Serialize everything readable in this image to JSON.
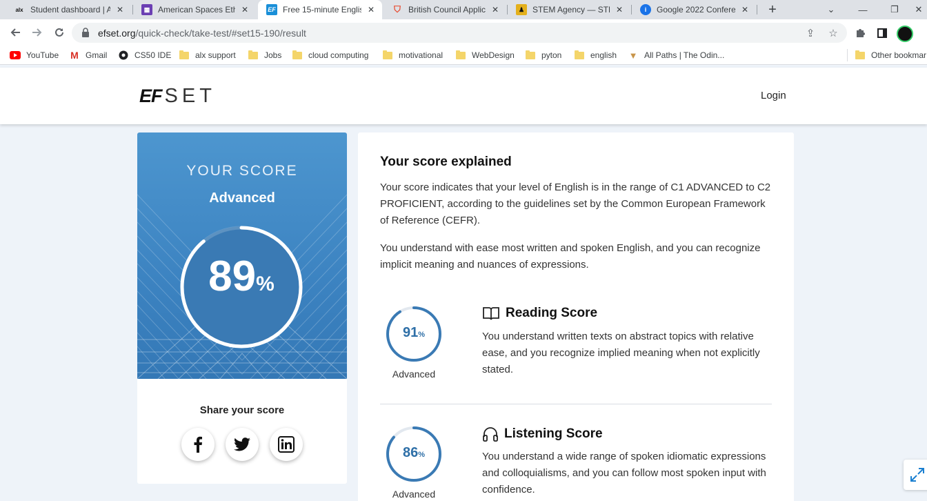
{
  "browser": {
    "tabs": [
      {
        "favicon": "alx",
        "title": "Student dashboard | A",
        "active": false
      },
      {
        "favicon": "purple-grid",
        "title": "American Spaces Ethic",
        "active": false
      },
      {
        "favicon": "EF",
        "title": "Free 15-minute Englis",
        "active": true
      },
      {
        "favicon": "b-shield",
        "title": "British Council Applica",
        "active": false
      },
      {
        "favicon": "stem-person",
        "title": "STEM Agency — STEM",
        "active": false
      },
      {
        "favicon": "info-blue",
        "title": "Google 2022 Confere",
        "active": false
      }
    ],
    "url_host": "efset.org",
    "url_path": "/quick-check/take-test/#set15-190/result",
    "bookmarks": [
      {
        "icon": "youtube-icon",
        "label": "YouTube"
      },
      {
        "icon": "gmail-icon",
        "label": "Gmail"
      },
      {
        "icon": "cs50-icon",
        "label": "CS50 IDE"
      },
      {
        "icon": "folder-icon",
        "label": "alx support"
      },
      {
        "icon": "folder-icon",
        "label": "Jobs"
      },
      {
        "icon": "folder-icon",
        "label": "cloud computing"
      },
      {
        "icon": "folder-icon",
        "label": "motivational"
      },
      {
        "icon": "folder-icon",
        "label": "WebDesign"
      },
      {
        "icon": "folder-icon",
        "label": "pyton"
      },
      {
        "icon": "folder-icon",
        "label": "english"
      },
      {
        "icon": "odin-icon",
        "label": "All Paths | The Odin..."
      }
    ],
    "other_bookmarks": "Other bookmar"
  },
  "header": {
    "logo_ef": "EF",
    "logo_set": "SET",
    "login": "Login"
  },
  "score": {
    "heading": "YOUR SCORE",
    "level": "Advanced",
    "value": "89",
    "percent_sign": "%",
    "fraction": 0.89
  },
  "share": {
    "title": "Share your score",
    "buttons": [
      "facebook-icon",
      "twitter-icon",
      "linkedin-icon"
    ]
  },
  "explain": {
    "title": "Your score explained",
    "paragraph1": "Your score indicates that your level of English is in the range of C1 ADVANCED to C2 PROFICIENT, according to the guidelines set by the Common European Framework of Reference (CEFR).",
    "paragraph2": "You understand with ease most written and spoken English, and you can recognize implicit meaning and nuances of expressions."
  },
  "subscores": [
    {
      "name": "Reading Score",
      "icon": "book-icon",
      "value": "91",
      "fraction": 0.91,
      "level": "Advanced",
      "description": "You understand written texts on abstract topics with relative ease, and you recognize implied meaning when not explicitly stated."
    },
    {
      "name": "Listening Score",
      "icon": "headphones-icon",
      "value": "86",
      "fraction": 0.86,
      "level": "Advanced",
      "description": "You understand a wide range of spoken idiomatic expressions and colloquialisms, and you can follow most spoken input with confidence."
    }
  ],
  "colors": {
    "accent": "#3c83c1",
    "ring": "#3a7ab4",
    "page_bg": "#eef3f9"
  }
}
